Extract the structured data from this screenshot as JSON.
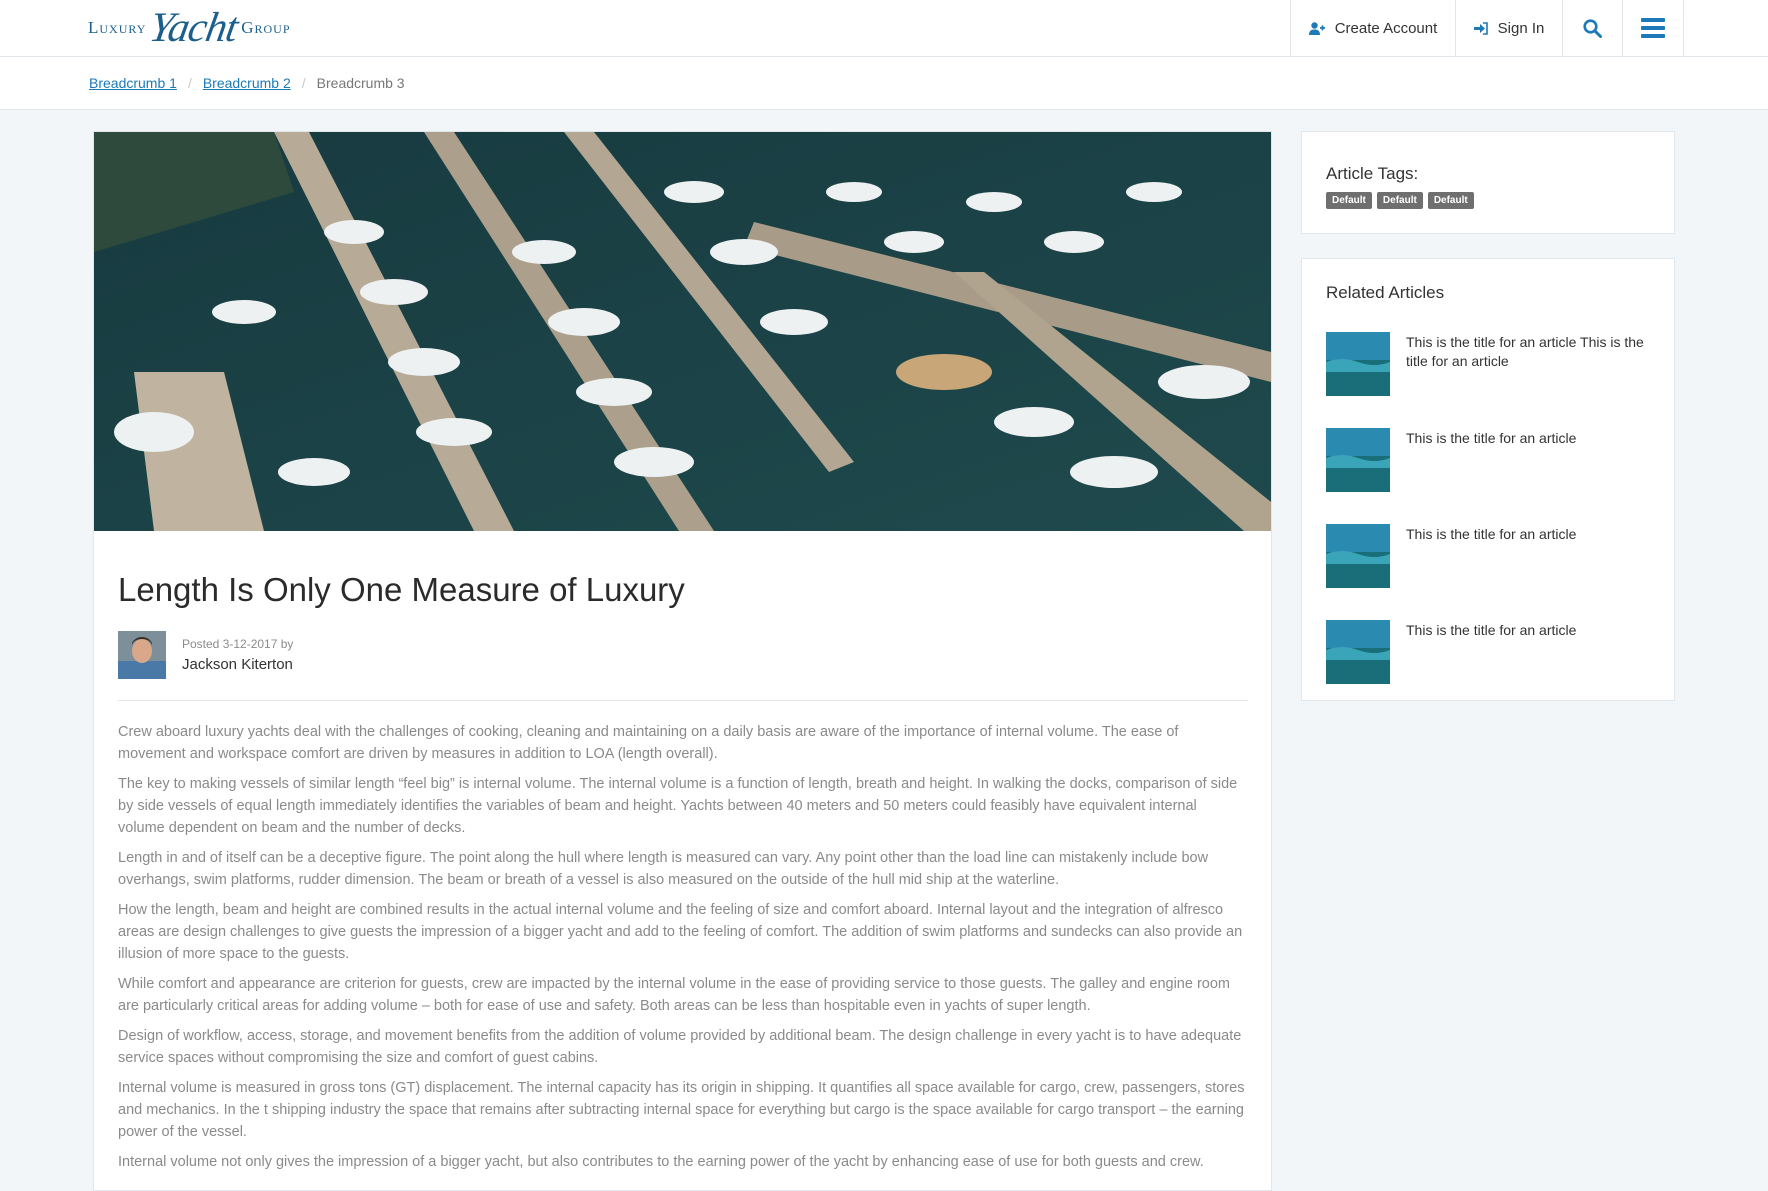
{
  "header": {
    "logo": {
      "left": "Luxury",
      "script": "Yacht",
      "right": "Group"
    },
    "create_account": "Create Account",
    "sign_in": "Sign In",
    "icons": {
      "create": "user-plus-icon",
      "signin": "sign-in-icon",
      "search": "search-icon",
      "menu": "hamburger-menu-icon"
    }
  },
  "breadcrumbs": [
    "Breadcrumb 1",
    "Breadcrumb 2",
    "Breadcrumb 3"
  ],
  "article": {
    "title": "Length Is Only One Measure of Luxury",
    "posted": "Posted 3-12-2017 by",
    "author": "Jackson Kiterton",
    "paragraphs": [
      "Crew aboard luxury yachts deal with the challenges of cooking, cleaning and maintaining on a daily basis are aware of the importance of internal volume. The ease of movement and workspace comfort are driven by measures in addition to LOA (length overall).",
      "The key to making vessels of similar length “feel big” is internal volume. The internal volume is a function of length, breath and height. In walking the docks, comparison of side by side vessels of equal length immediately identifies the variables of beam and height. Yachts between 40 meters and 50 meters could feasibly have equivalent internal volume dependent on beam and the number of decks.",
      "Length in and of itself can be a deceptive figure. The point along the hull where length is measured can vary. Any point other than the load line can mistakenly include bow overhangs, swim platforms, rudder dimension. The beam or breath of a vessel is also measured on the outside of the hull mid ship at the waterline.",
      "How the length, beam and height are combined results in the actual internal volume and the feeling of size and comfort aboard. Internal layout and the integration of alfresco areas are design challenges to give guests the impression of a bigger yacht and add to the feeling of comfort. The addition of swim platforms and sundecks can also provide an illusion of more space to the guests.",
      "While comfort and appearance are criterion for guests, crew are impacted by the internal volume in the ease of providing service to those guests. The galley and engine room are particularly critical areas for adding volume – both for ease of use and safety. Both areas can be less than hospitable even in yachts of super length.",
      "Design of workflow, access, storage, and movement benefits from the addition of volume provided by additional beam. The design challenge in every yacht is to have adequate service spaces without compromising the size and comfort of guest cabins.",
      "Internal volume is measured in gross tons (GT) displacement. The internal capacity has its origin in shipping. It quantifies all space available for cargo, crew, passengers, stores and mechanics. In the t shipping industry the space that remains after subtracting internal space for everything but cargo is the space available for cargo transport – the earning power of the vessel.",
      "Internal volume not only gives the impression of a bigger yacht, but also contributes to the earning power of the yacht by enhancing ease of use for both guests and crew."
    ]
  },
  "sidebar": {
    "tags_title": "Article Tags:",
    "tags": [
      "Default",
      "Default",
      "Default"
    ],
    "related_title": "Related Articles",
    "related": [
      "This is the title for an article This is the title for an article",
      "This is the title for an article",
      "This is the title for an article",
      "This is the title for an article"
    ]
  },
  "colors": {
    "accent": "#1c7ab8",
    "brand": "#1d5f8c",
    "tag_bg": "#6f6f6f",
    "page_bg": "#f2f6f9"
  }
}
